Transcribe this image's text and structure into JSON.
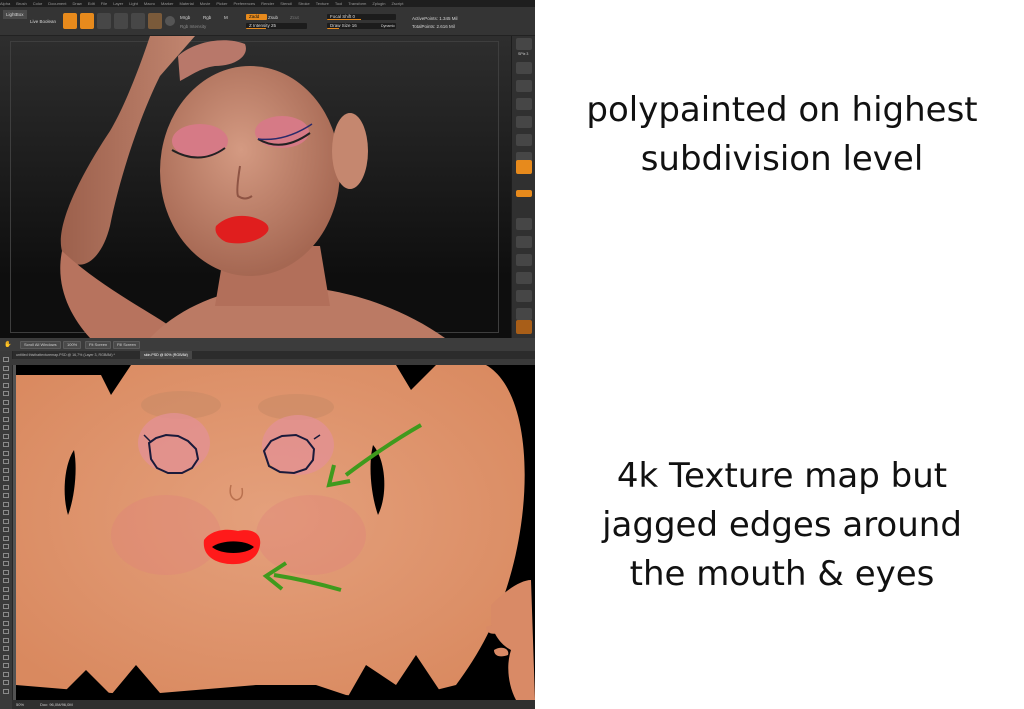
{
  "zbrush": {
    "menu": [
      "Alpha",
      "Brush",
      "Color",
      "Document",
      "Draw",
      "Edit",
      "File",
      "Layer",
      "Light",
      "Macro",
      "Marker",
      "Material",
      "Movie",
      "Picker",
      "Preferences",
      "Render",
      "Stencil",
      "Stroke",
      "Texture",
      "Tool",
      "Transform",
      "Zplugin",
      "Zscript"
    ],
    "lightbox_label": "LightBox",
    "live_boolean_label": "Live Boolean",
    "tools": {
      "edit": "Edit",
      "draw": "Draw",
      "move": "Move",
      "scale": "Scale",
      "rotate": "Rotate"
    },
    "mrgb_label": "Mrgb",
    "rgb_label": "Rgb",
    "m_label": "M",
    "rgb_intensity_label": "Rgb Intensity",
    "zadd_label": "Zadd",
    "zsub_label": "Zsub",
    "zcut_label": "Zcut",
    "z_intensity_label": "Z Intensity 25",
    "focal_shift_label": "Focal Shift 0",
    "draw_size_label": "Draw Size 16",
    "dynamic_label": "Dynamic",
    "active_points_label": "ActivePoints: 1.345 Mil",
    "total_points_label": "TotalPoints: 2.616 Mil",
    "spix_label": "SPix 3",
    "colors": {
      "accent": "#e78a1c",
      "skin": "#c98a72",
      "lips": "#e01e1e",
      "eyeshadow": "#d67a86"
    }
  },
  "photoshop": {
    "options": {
      "scroll_all": "Scroll All Windows",
      "zoom": "100%",
      "fit": "Fit Screen",
      "fill": "Fill Screen"
    },
    "tabs": [
      {
        "label": "untitled thisthattexturemap.PSD @ 16,7% (Layer 3, RGB/8#) *"
      },
      {
        "label": "skin.PSD @ 50% (RGB/8#)"
      }
    ],
    "status_zoom": "50%",
    "status_doc": "Doc: 96,0M/96,0M",
    "colors": {
      "skin": "#dc8e6c",
      "arrow": "#3f9a1d",
      "lips": "#ff1a1a"
    }
  },
  "captions": {
    "top": [
      "polypainted on highest",
      "subdivision level"
    ],
    "bottom": [
      "4k Texture map but",
      "jagged edges around",
      "the mouth & eyes"
    ]
  }
}
